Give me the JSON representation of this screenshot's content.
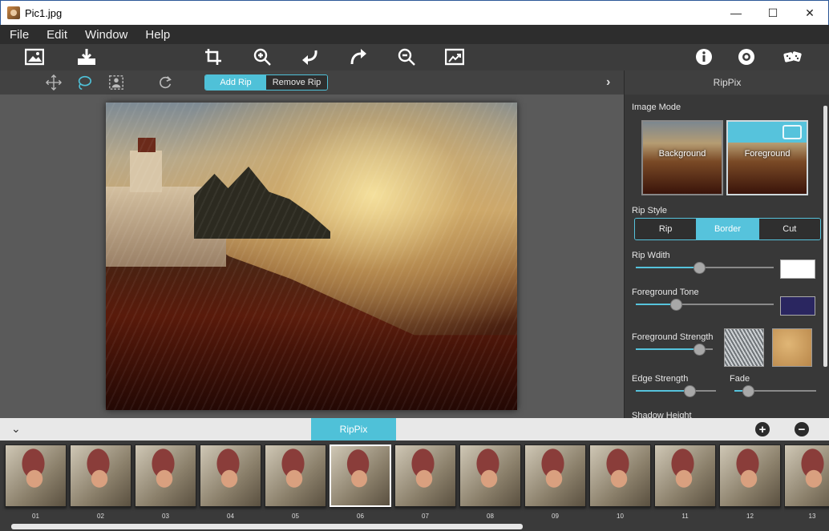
{
  "window": {
    "title": "Pic1.jpg",
    "min": "—",
    "max": "☐",
    "close": "✕"
  },
  "menu": [
    "File",
    "Edit",
    "Window",
    "Help"
  ],
  "toolbar": {
    "icons": [
      "open-image-icon",
      "save-icon",
      "crop-icon",
      "zoom-in-icon",
      "undo-icon",
      "redo-icon",
      "zoom-out-icon",
      "fit-image-icon",
      "info-icon",
      "settings-icon",
      "random-icon"
    ]
  },
  "subtoolbar": {
    "icons": [
      "move-icon",
      "lasso-icon",
      "select-icon",
      "reset-icon"
    ],
    "add_rip": "Add Rip",
    "remove_rip": "Remove Rip",
    "expand": "›"
  },
  "panel": {
    "title": "RipPix",
    "image_mode_label": "Image Mode",
    "mode_background": "Background",
    "mode_foreground": "Foreground",
    "rip_style_label": "Rip Style",
    "styles": [
      "Rip",
      "Border",
      "Cut"
    ],
    "selected_style": "Border",
    "rip_width_label": "Rip Wdith",
    "rip_width_value": 0.46,
    "rip_width_color": "#ffffff",
    "fg_tone_label": "Foreground Tone",
    "fg_tone_value": 0.29,
    "fg_tone_color": "#2a2660",
    "fg_strength_label": "Foreground Strength",
    "fg_strength_value": 0.82,
    "edge_strength_label": "Edge Strength",
    "edge_strength_value": 0.67,
    "fade_label": "Fade",
    "fade_value": 0.17,
    "shadow_height_label": "Shadow Height"
  },
  "bottom": {
    "tab": "RipPix",
    "collapse": "⌄",
    "add": "+",
    "remove": "−"
  },
  "filmstrip": {
    "items": [
      "01",
      "02",
      "03",
      "04",
      "05",
      "06",
      "07",
      "08",
      "09",
      "10",
      "11",
      "12",
      "13"
    ],
    "selected": "06"
  },
  "accent": "#4fc1d8"
}
